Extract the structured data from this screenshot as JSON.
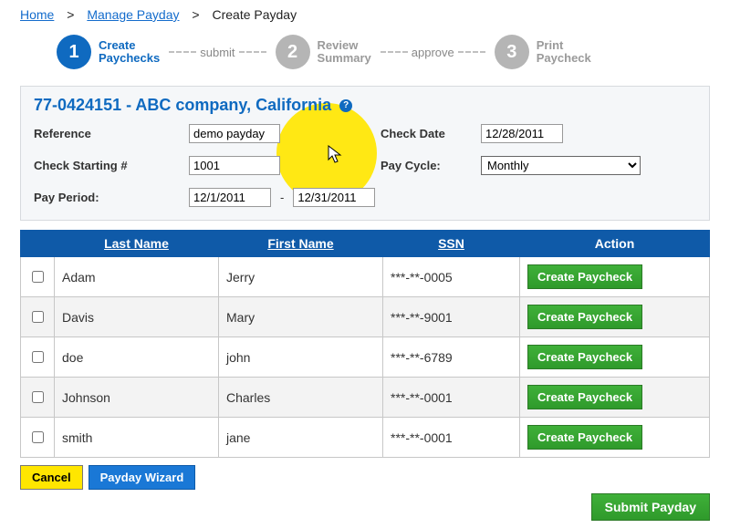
{
  "breadcrumb": {
    "home": "Home",
    "manage": "Manage Payday",
    "current": "Create Payday"
  },
  "wizard": {
    "step1_num": "1",
    "step1_a": "Create",
    "step1_b": "Paychecks",
    "conn1": "submit",
    "step2_num": "2",
    "step2_a": "Review",
    "step2_b": "Summary",
    "conn2": "approve",
    "step3_num": "3",
    "step3_a": "Print",
    "step3_b": "Paycheck"
  },
  "company": "77-0424151 - ABC company, California",
  "labels": {
    "reference": "Reference",
    "check_start": "Check Starting #",
    "pay_period": "Pay Period:",
    "check_date": "Check Date",
    "pay_cycle": "Pay Cycle:"
  },
  "form": {
    "reference": "demo payday",
    "check_start": "1001",
    "period_from": "12/1/2011",
    "period_to": "12/31/2011",
    "check_date": "12/28/2011",
    "pay_cycle": "Monthly"
  },
  "table": {
    "headers": {
      "last": "Last Name",
      "first": "First Name",
      "ssn": "SSN",
      "action": "Action"
    },
    "action_label": "Create Paycheck",
    "rows": [
      {
        "last": "Adam",
        "first": "Jerry",
        "ssn": "***-**-0005"
      },
      {
        "last": "Davis",
        "first": "Mary",
        "ssn": "***-**-9001"
      },
      {
        "last": "doe",
        "first": "john",
        "ssn": "***-**-6789"
      },
      {
        "last": "Johnson",
        "first": "Charles",
        "ssn": "***-**-0001"
      },
      {
        "last": "smith",
        "first": "jane",
        "ssn": "***-**-0001"
      }
    ]
  },
  "buttons": {
    "cancel": "Cancel",
    "wizard": "Payday Wizard",
    "submit": "Submit Payday"
  }
}
